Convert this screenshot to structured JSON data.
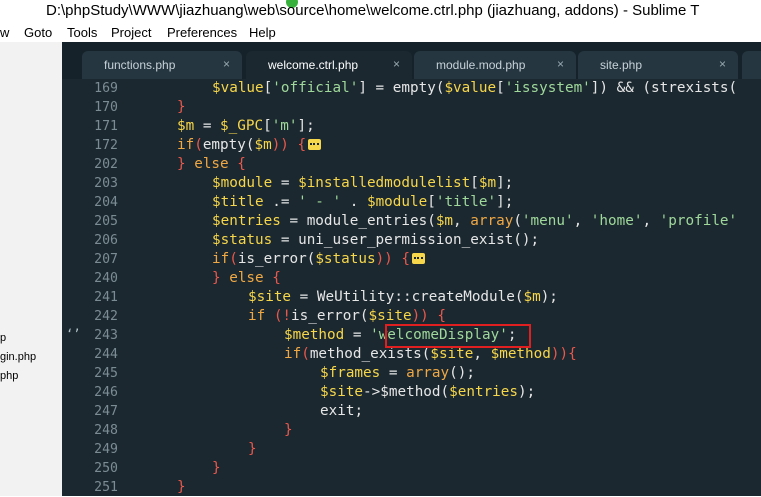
{
  "window": {
    "title": "D:\\phpStudy\\WWW\\jiazhuang\\web\\source\\home\\welcome.ctrl.php (jiazhuang, addons) - Sublime T"
  },
  "menu": [
    "w",
    "Goto",
    "Tools",
    "Project",
    "Preferences",
    "Help"
  ],
  "sidebar": {
    "files": [
      "p",
      "gin.php",
      "php"
    ]
  },
  "tabs": [
    {
      "label": "functions.php",
      "close": "×",
      "active": false
    },
    {
      "label": "welcome.ctrl.php",
      "close": "×",
      "active": true
    },
    {
      "label": "module.mod.php",
      "close": "×",
      "active": false
    },
    {
      "label": "site.php",
      "close": "×",
      "active": false
    }
  ],
  "lines": [
    {
      "no": "169",
      "mark": ""
    },
    {
      "no": "170",
      "mark": ""
    },
    {
      "no": "171",
      "mark": ""
    },
    {
      "no": "172",
      "mark": ""
    },
    {
      "no": "202",
      "mark": ""
    },
    {
      "no": "203",
      "mark": ""
    },
    {
      "no": "204",
      "mark": ""
    },
    {
      "no": "205",
      "mark": ""
    },
    {
      "no": "206",
      "mark": ""
    },
    {
      "no": "207",
      "mark": ""
    },
    {
      "no": "240",
      "mark": ""
    },
    {
      "no": "241",
      "mark": ""
    },
    {
      "no": "242",
      "mark": ""
    },
    {
      "no": "243",
      "mark": "‘’"
    },
    {
      "no": "244",
      "mark": ""
    },
    {
      "no": "245",
      "mark": ""
    },
    {
      "no": "246",
      "mark": ""
    },
    {
      "no": "247",
      "mark": ""
    },
    {
      "no": "248",
      "mark": ""
    },
    {
      "no": "249",
      "mark": ""
    },
    {
      "no": "250",
      "mark": ""
    },
    {
      "no": "251",
      "mark": ""
    }
  ],
  "code": {
    "l169": {
      "a": "$value",
      "b": "[",
      "c": "'official'",
      "d": "] = ",
      "e": "empty",
      "f": "(",
      "g": "$value",
      "h": "[",
      "i": "'issystem'",
      "j": "]) && (",
      "k": "strexists("
    },
    "l170": {
      "a": "}"
    },
    "l171": {
      "a": "$m",
      "b": " = ",
      "c": "$_GPC",
      "d": "[",
      "e": "'m'",
      "f": "];"
    },
    "l172": {
      "a": "if",
      "b": "(",
      "c": "empty",
      "d": "(",
      "e": "$m",
      "f": ")) {"
    },
    "l202": {
      "a": "} ",
      "b": "else",
      "c": " {"
    },
    "l203": {
      "a": "$module",
      "b": " = ",
      "c": "$installedmodulelist",
      "d": "[",
      "e": "$m",
      "f": "];"
    },
    "l204": {
      "a": "$title",
      "b": " .= ",
      "c": "' - '",
      "d": " . ",
      "e": "$module",
      "f": "[",
      "g": "'title'",
      "h": "];"
    },
    "l205": {
      "a": "$entries",
      "b": " = ",
      "c": "module_entries",
      "d": "(",
      "e": "$m",
      "f": ", ",
      "g": "array",
      "h": "(",
      "i": "'menu'",
      "j": ", ",
      "k": "'home'",
      "l": ", ",
      "m": "'profile'"
    },
    "l206": {
      "a": "$status",
      "b": " = ",
      "c": "uni_user_permission_exist",
      "d": "();"
    },
    "l207": {
      "a": "if",
      "b": "(",
      "c": "is_error",
      "d": "(",
      "e": "$status",
      "f": ")) {"
    },
    "l240": {
      "a": "} ",
      "b": "else",
      "c": " {"
    },
    "l241": {
      "a": "$site",
      "b": " = ",
      "c": "WeUtility",
      "d": "::",
      "e": "createModule",
      "f": "(",
      "g": "$m",
      "h": ");"
    },
    "l242": {
      "a": "if",
      "b": " (!",
      "c": "is_error",
      "d": "(",
      "e": "$site",
      "f": ")) {"
    },
    "l243": {
      "a": "$method",
      "b": " = ",
      "c": "'welcomeDisplay'",
      "d": ";"
    },
    "l244": {
      "a": "if",
      "b": "(",
      "c": "method_exists",
      "d": "(",
      "e": "$site",
      "f": ", ",
      "g": "$method",
      "h": ")){"
    },
    "l245": {
      "a": "$frames",
      "b": " = ",
      "c": "array",
      "d": "();"
    },
    "l246": {
      "a": "$site",
      "b": "->",
      "c": "$method",
      "d": "(",
      "e": "$entries",
      "f": ");"
    },
    "l247": {
      "a": "exit",
      "b": ";"
    },
    "l248": {
      "a": "}"
    },
    "l249": {
      "a": "}"
    },
    "l250": {
      "a": "}"
    },
    "l251": {
      "a": "}"
    }
  },
  "colors": {
    "editor_bg": "#1b2830",
    "variable": "#f6d64a",
    "string": "#9fd89a",
    "keyword": "#f0a844",
    "bracket": "#e9584c",
    "highlight_box": "#e02020"
  }
}
